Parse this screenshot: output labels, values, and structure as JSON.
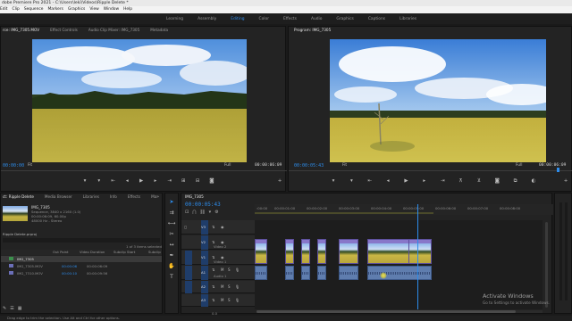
{
  "app": {
    "title": "dobe Premiere Pro 2021 - C:\\Users\\leki\\Videos\\Ripple Delete *"
  },
  "menu": [
    "Edit",
    "Clip",
    "Sequence",
    "Markers",
    "Graphics",
    "View",
    "Window",
    "Help"
  ],
  "workspaces": {
    "items": [
      "Learning",
      "Assembly",
      "Editing",
      "Color",
      "Effects",
      "Audio",
      "Graphics",
      "Captions",
      "Libraries"
    ],
    "active": "Editing"
  },
  "source_panel": {
    "tabs": [
      "Effect Controls",
      "Audio Clip Mixer: IMG_7305",
      "Metadata"
    ],
    "active_tab_prefix": "rce: IMG_7305.MOV",
    "left_tc": "00:00:00",
    "fit": "Fit",
    "quality": "Full",
    "right_tc": "00:00:06:09"
  },
  "program_panel": {
    "title": "Program: IMG_7305",
    "left_tc": "00:00:05:43",
    "fit": "Fit",
    "quality": "Full",
    "right_tc": "00:00:06:09"
  },
  "project_panel": {
    "tabs": [
      "ct: Ripple Delete",
      "Media Browser",
      "Libraries",
      "Info",
      "Effects",
      "Ma"
    ],
    "clip_name": "IMG_7305",
    "clip_info_1": "Sequence, 3840 x 2160 (1.0)",
    "clip_info_2": "00:00:06:09, 60.00p",
    "clip_info_3": "48000 Hz - Stereo",
    "project_file": "Ripple Delete.prproj",
    "selection": "1 of 3 items selected",
    "columns": [
      "Out Point",
      "Video Duration",
      "Subclip Start",
      "Subclip"
    ],
    "rows": [
      {
        "name": "IMG_7305",
        "out": "",
        "duration": ""
      },
      {
        "name": "IMG_7305.MOV",
        "out": "00:00:06",
        "duration": "00:00:06:09"
      },
      {
        "name": "IMG_7310.MOV",
        "out": "00:00:10",
        "duration": "00:00:09:56"
      }
    ]
  },
  "timeline": {
    "tab": "IMG_7305",
    "timecode": "00:00:05:43",
    "ruler": [
      ":00:00",
      "00:00:01:00",
      "00:00:02:00",
      "00:00:03:00",
      "00:00:04:00",
      "00:00:05:00",
      "00:00:06:00",
      "00:00:07:00",
      "00:00:08:00"
    ],
    "tracks": [
      {
        "id": "V3",
        "label": ""
      },
      {
        "id": "V2",
        "label": "Video 2"
      },
      {
        "id": "V1",
        "label": "Video 1"
      },
      {
        "id": "A1",
        "label": "Audio 1"
      },
      {
        "id": "A2",
        "label": "Audio 2"
      },
      {
        "id": "A3",
        "label": "Audio 3"
      }
    ],
    "mix_value": "0.0"
  },
  "watermark": {
    "line1": "Activate Windows",
    "line2": "Go to Settings to activate Windows."
  },
  "status_bar": "Drag edge to trim the selection. Use Alt and Ctrl for other options.",
  "colors": {
    "accent": "#2d8ceb",
    "video_clip": "#8877c9",
    "audio_clip": "#5f7dae"
  }
}
